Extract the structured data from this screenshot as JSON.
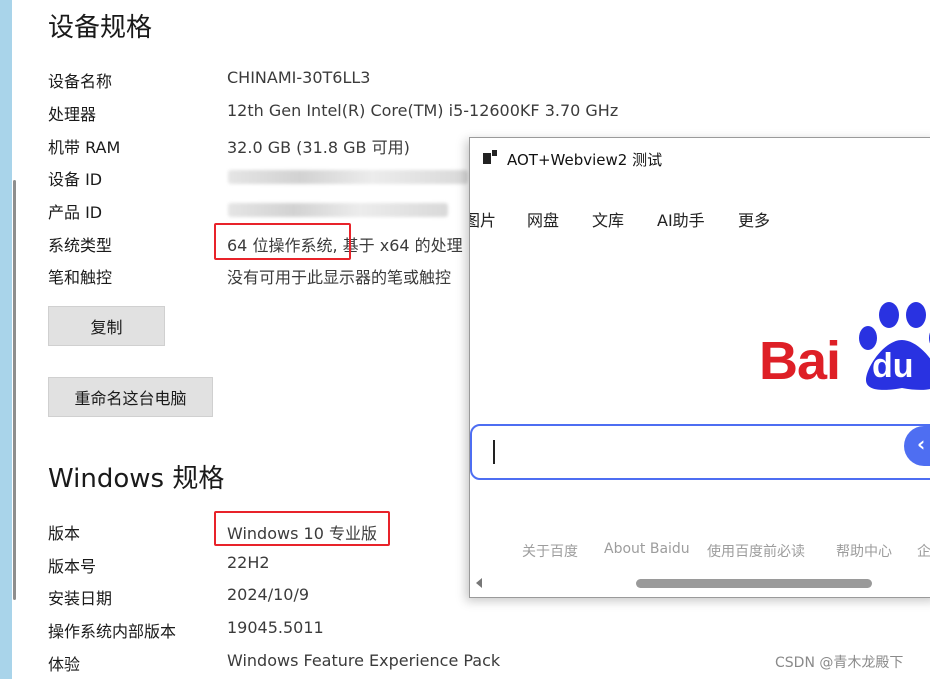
{
  "device_specs": {
    "title": "设备规格",
    "rows": [
      {
        "label": "设备名称",
        "value": "CHINAMI-30T6LL3"
      },
      {
        "label": "处理器",
        "value": "12th Gen Intel(R) Core(TM) i5-12600KF   3.70 GHz"
      },
      {
        "label": "机带 RAM",
        "value": "32.0 GB (31.8 GB 可用)"
      },
      {
        "label": "设备 ID",
        "value": ""
      },
      {
        "label": "产品 ID",
        "value": ""
      },
      {
        "label": "系统类型",
        "value_highlight": "64 位操作系统,",
        "value_rest": " 基于 x64 的处理"
      },
      {
        "label": "笔和触控",
        "value": "没有可用于此显示器的笔或触控"
      }
    ],
    "copy_button": "复制",
    "rename_button": "重命名这台电脑"
  },
  "windows_specs": {
    "title": "Windows 规格",
    "rows": [
      {
        "label": "版本",
        "value": "Windows 10 专业版"
      },
      {
        "label": "版本号",
        "value": "22H2"
      },
      {
        "label": "安装日期",
        "value": "2024/10/9"
      },
      {
        "label": "操作系统内部版本",
        "value": "19045.5011"
      },
      {
        "label": "体验",
        "value": "Windows Feature Experience Pack"
      }
    ]
  },
  "webview": {
    "title": "AOT+Webview2 测试",
    "nav": [
      "图片",
      "网盘",
      "文库",
      "AI助手",
      "更多"
    ],
    "logo_text": "Bai",
    "logo_paw_text": "du",
    "footer": [
      "关于百度",
      "About Baidu",
      "使用百度前必读",
      "帮助中心",
      "企"
    ]
  },
  "watermark": "CSDN @青木龙殿下",
  "colors": {
    "highlight_box": "#e8232a",
    "baidu_red": "#de1f26",
    "baidu_blue": "#2932e1",
    "search_border": "#4e6ef2"
  }
}
